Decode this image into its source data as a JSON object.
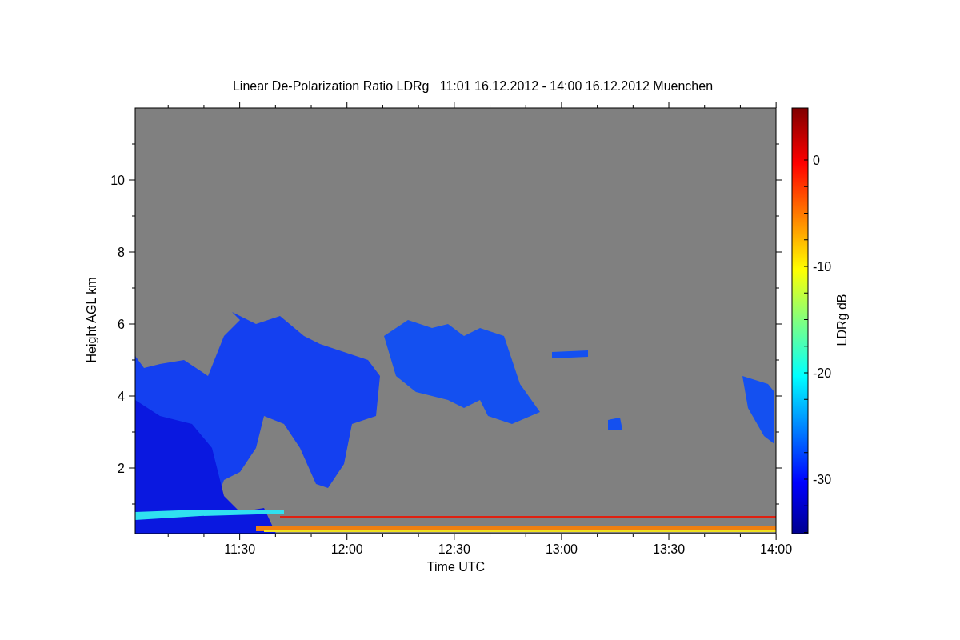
{
  "title": "Linear De-Polarization Ratio LDRg   11:01 16.12.2012 - 14:00 16.12.2012 Muenchen",
  "y_axis": {
    "label": "Height AGL km",
    "ticks": [
      "10",
      "8",
      "6",
      "4",
      "2"
    ]
  },
  "x_axis": {
    "label": "Time UTC",
    "ticks": [
      "11:30",
      "12:00",
      "12:30",
      "13:00",
      "13:30",
      "14:00"
    ]
  },
  "colorbar": {
    "label": "LDRg dB",
    "ticks": [
      "0",
      "-10",
      "-20",
      "-30"
    ]
  }
}
